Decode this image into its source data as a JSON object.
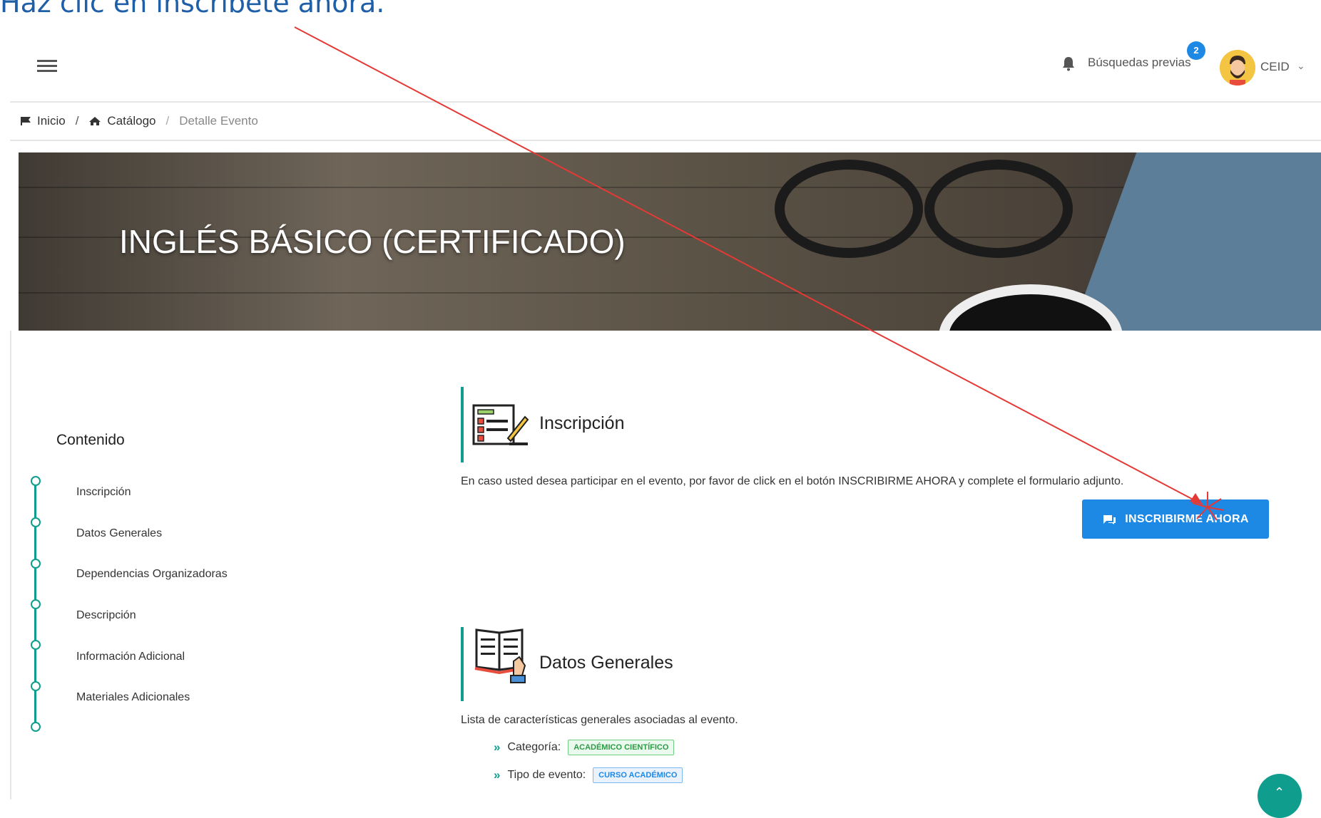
{
  "instruction": "Haz clic en inscríbete ahora.",
  "topbar": {
    "prev_search_label": "Búsquedas previas",
    "notification_count": "2",
    "username": "CEID"
  },
  "breadcrumb": {
    "home": "Inicio",
    "catalog": "Catálogo",
    "current": "Detalle Evento"
  },
  "hero": {
    "title": "INGLÉS BÁSICO (CERTIFICADO)"
  },
  "toc": {
    "title": "Contenido",
    "items": [
      "Inscripción",
      "Datos Generales",
      "Dependencias Organizadoras",
      "Descripción",
      "Información Adicional",
      "Materiales Adicionales"
    ]
  },
  "inscripcion": {
    "heading": "Inscripción",
    "text": "En caso usted desea participar en el evento, por favor de click en el botón INSCRIBIRME AHORA y complete el formulario adjunto.",
    "button_label": "INSCRIBIRME AHORA"
  },
  "datos_generales": {
    "heading": "Datos Generales",
    "text": "Lista de características generales asociadas al evento.",
    "items": [
      {
        "label": "Categoría:",
        "tag": "ACADÉMICO CIENTÍFICO",
        "tag_color": "#2e9a44"
      },
      {
        "label": "Tipo de evento:",
        "tag": "CURSO ACADÉMICO",
        "tag_color": "#1e88e5"
      }
    ]
  },
  "colors": {
    "accent": "#0f9d8e",
    "primary_button": "#1e88e5",
    "annotation_arrow": "#e53935"
  }
}
